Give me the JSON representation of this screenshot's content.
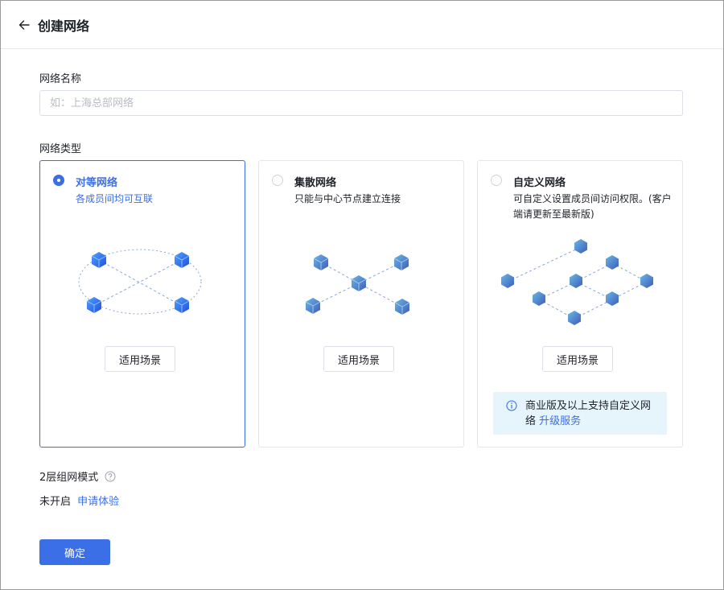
{
  "header": {
    "title": "创建网络",
    "back_icon": "arrow-left-icon"
  },
  "form": {
    "name_label": "网络名称",
    "name_placeholder": "如：上海总部网络",
    "name_value": "",
    "type_label": "网络类型"
  },
  "network_types": [
    {
      "title": "对等网络",
      "description": "各成员间均可互联",
      "selected": true,
      "scene_button": "适用场景"
    },
    {
      "title": "集散网络",
      "description": "只能与中心节点建立连接",
      "selected": false,
      "scene_button": "适用场景"
    },
    {
      "title": "自定义网络",
      "description": "可自定义设置成员间访问权限。(客户端请更新至最新版)",
      "selected": false,
      "scene_button": "适用场景",
      "notice": {
        "icon": "info-icon",
        "text": "商业版及以上支持自定义网络",
        "link": "升级服务"
      }
    }
  ],
  "two_layer": {
    "label": "2层组网模式",
    "help_icon": "question-circle-icon",
    "status": "未开启",
    "apply_link": "申请体验"
  },
  "confirm_button": "确定",
  "colors": {
    "primary": "#3a6fe8",
    "notice_bg": "#e6f4fc",
    "border": "#e4e6ea"
  }
}
